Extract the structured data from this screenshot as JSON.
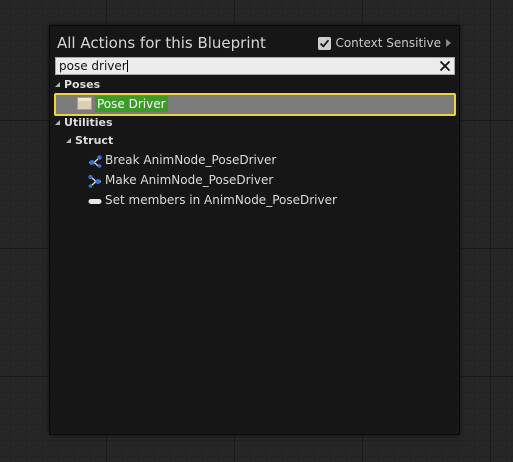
{
  "window": {
    "title": "All Actions for this Blueprint",
    "context_sensitive_label": "Context Sensitive",
    "context_sensitive_checked": true
  },
  "search": {
    "value": "pose driver"
  },
  "tree": {
    "poses": {
      "label": "Poses",
      "items": [
        {
          "label": "Pose Driver",
          "icon": "anim-node-icon",
          "selected": true
        }
      ]
    },
    "utilities": {
      "label": "Utilities",
      "struct": {
        "label": "Struct",
        "items": [
          {
            "label": "Break AnimNode_PoseDriver",
            "icon": "break-struct-icon"
          },
          {
            "label": "Make AnimNode_PoseDriver",
            "icon": "make-struct-icon"
          },
          {
            "label": "Set members in AnimNode_PoseDriver",
            "icon": "set-members-icon"
          }
        ]
      }
    }
  },
  "colors": {
    "selection_border": "#e8d63a",
    "highlight": "#3d9a2a",
    "struct_pin": "#3a6fd8"
  }
}
